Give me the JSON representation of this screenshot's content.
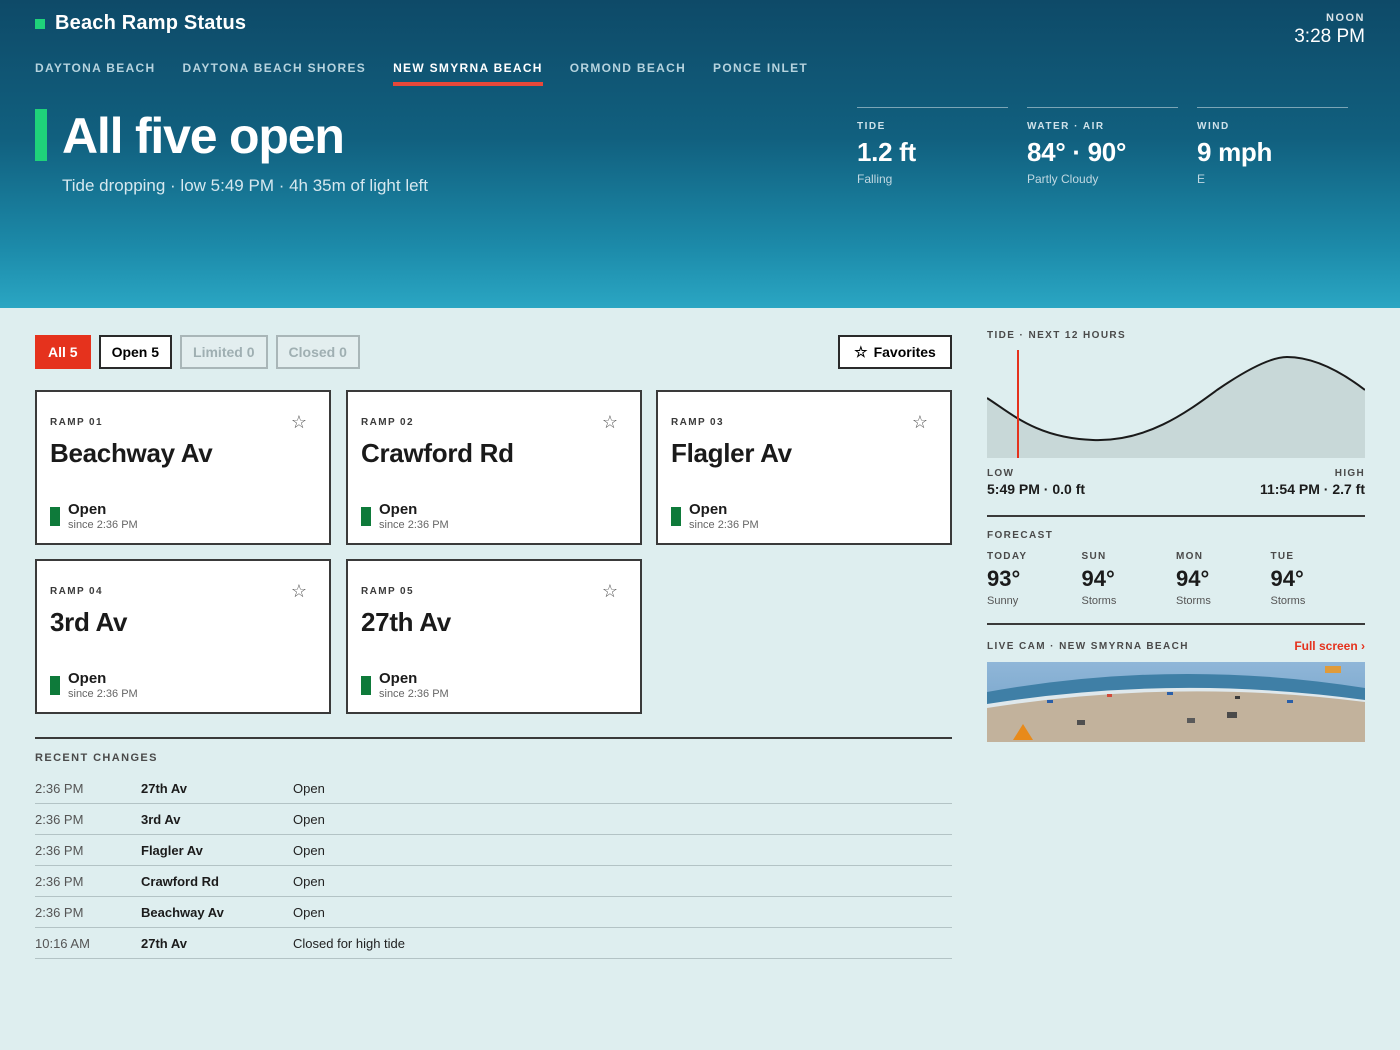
{
  "app": {
    "title": "Beach Ramp Status"
  },
  "clock": {
    "label": "NOON",
    "time": "3:28 PM"
  },
  "nav": {
    "tabs": [
      {
        "label": "DAYTONA BEACH",
        "active": false
      },
      {
        "label": "DAYTONA BEACH SHORES",
        "active": false
      },
      {
        "label": "NEW SMYRNA BEACH",
        "active": true
      },
      {
        "label": "ORMOND BEACH",
        "active": false
      },
      {
        "label": "PONCE INLET",
        "active": false
      }
    ]
  },
  "hero": {
    "headline": "All five open",
    "subline": "Tide dropping · low 5:49 PM · 4h 35m of light left",
    "stats": [
      {
        "label": "TIDE",
        "value": "1.2 ft",
        "sub": "Falling"
      },
      {
        "label": "WATER · AIR",
        "value": "84° · 90°",
        "sub": "Partly Cloudy"
      },
      {
        "label": "WIND",
        "value": "9 mph",
        "sub": "E"
      }
    ]
  },
  "filters": {
    "chips": [
      {
        "label": "All 5",
        "state": "selected"
      },
      {
        "label": "Open 5",
        "state": "normal"
      },
      {
        "label": "Limited 0",
        "state": "disabled"
      },
      {
        "label": "Closed 0",
        "state": "disabled"
      }
    ],
    "favorites_label": "Favorites"
  },
  "ramps": [
    {
      "kicker": "RAMP 01",
      "name": "Beachway Av",
      "status": "Open",
      "since": "since 2:36 PM"
    },
    {
      "kicker": "RAMP 02",
      "name": "Crawford Rd",
      "status": "Open",
      "since": "since 2:36 PM"
    },
    {
      "kicker": "RAMP 03",
      "name": "Flagler Av",
      "status": "Open",
      "since": "since 2:36 PM"
    },
    {
      "kicker": "RAMP 04",
      "name": "3rd Av",
      "status": "Open",
      "since": "since 2:36 PM"
    },
    {
      "kicker": "RAMP 05",
      "name": "27th Av",
      "status": "Open",
      "since": "since 2:36 PM"
    }
  ],
  "recent": {
    "title": "RECENT CHANGES",
    "rows": [
      {
        "time": "2:36 PM",
        "ramp": "27th Av",
        "status": "Open"
      },
      {
        "time": "2:36 PM",
        "ramp": "3rd Av",
        "status": "Open"
      },
      {
        "time": "2:36 PM",
        "ramp": "Flagler Av",
        "status": "Open"
      },
      {
        "time": "2:36 PM",
        "ramp": "Crawford Rd",
        "status": "Open"
      },
      {
        "time": "2:36 PM",
        "ramp": "Beachway Av",
        "status": "Open"
      },
      {
        "time": "10:16 AM",
        "ramp": "27th Av",
        "status": "Closed for high tide"
      }
    ]
  },
  "tide": {
    "title": "TIDE · NEXT 12 HOURS",
    "low": {
      "label": "LOW",
      "value": "5:49 PM · 0.0 ft"
    },
    "high": {
      "label": "HIGH",
      "value": "11:54 PM · 2.7 ft"
    }
  },
  "forecast": {
    "title": "FORECAST",
    "days": [
      {
        "day": "TODAY",
        "temp": "93°",
        "cond": "Sunny"
      },
      {
        "day": "SUN",
        "temp": "94°",
        "cond": "Storms"
      },
      {
        "day": "MON",
        "temp": "94°",
        "cond": "Storms"
      },
      {
        "day": "TUE",
        "temp": "94°",
        "cond": "Storms"
      }
    ]
  },
  "cam": {
    "title": "LIVE CAM · NEW SMYRNA BEACH",
    "link": "Full screen ›"
  },
  "colors": {
    "accent_green": "#1fd27a",
    "accent_red": "#e5321d",
    "status_open": "#0e7a3a"
  }
}
